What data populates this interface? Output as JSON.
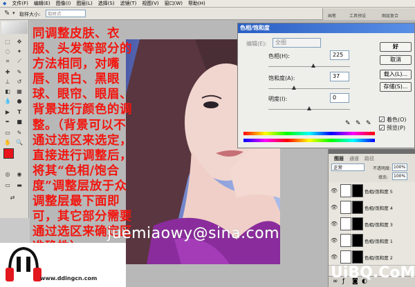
{
  "menubar": {
    "items": [
      "文件(F)",
      "编辑(E)",
      "图像(I)",
      "图层(L)",
      "选择(S)",
      "滤镜(T)",
      "视图(V)",
      "窗口(W)",
      "帮助(H)"
    ]
  },
  "optbar": {
    "sample_label": "取样大小:",
    "sample_value": "取样点",
    "tabs": [
      "画笔",
      "工具预设",
      "图层复合"
    ]
  },
  "note": "同调整皮肤、衣服、头发等部分的方法相同，对嘴唇、眼白、黑眼球、眼帘、眼眉、背景进行颜色的调整。（背景可以不通过选区来选定，直接进行调整后，将其“色相/饱合度”调整层放于众调整层最下面即可，其它部分需要通过选区来确定区准确性）",
  "dialog": {
    "title": "色相/饱和度",
    "edit_label": "编辑(E):",
    "edit_value": "全图",
    "hue_label": "色相(H):",
    "hue_value": "225",
    "sat_label": "饱和度(A):",
    "sat_value": "37",
    "light_label": "明度(I):",
    "light_value": "0",
    "ok": "好",
    "cancel": "取消",
    "load": "载入(L)...",
    "save": "存储(S)...",
    "colorize": "着色(O)",
    "preview": "预览(P)",
    "slider_levels": {
      "hue": 0.55,
      "sat": 0.31,
      "light": 0.5
    }
  },
  "layers": {
    "tabs": [
      "图层",
      "通道",
      "路径"
    ],
    "mode": "正常",
    "opacity_label": "不透明度:",
    "opacity": "100%",
    "fill_label": "填充:",
    "fill": "100%",
    "rows": [
      "色相/饱和度 5",
      "色相/饱和度 4",
      "色相/饱和度 3",
      "色相/饱和度 1",
      "色相/饱和度 2"
    ]
  },
  "watermark": "juemiaowy@sina.com",
  "site_logo": "UiBQ.CoM",
  "ddingcn": "www.ddingcn.com"
}
